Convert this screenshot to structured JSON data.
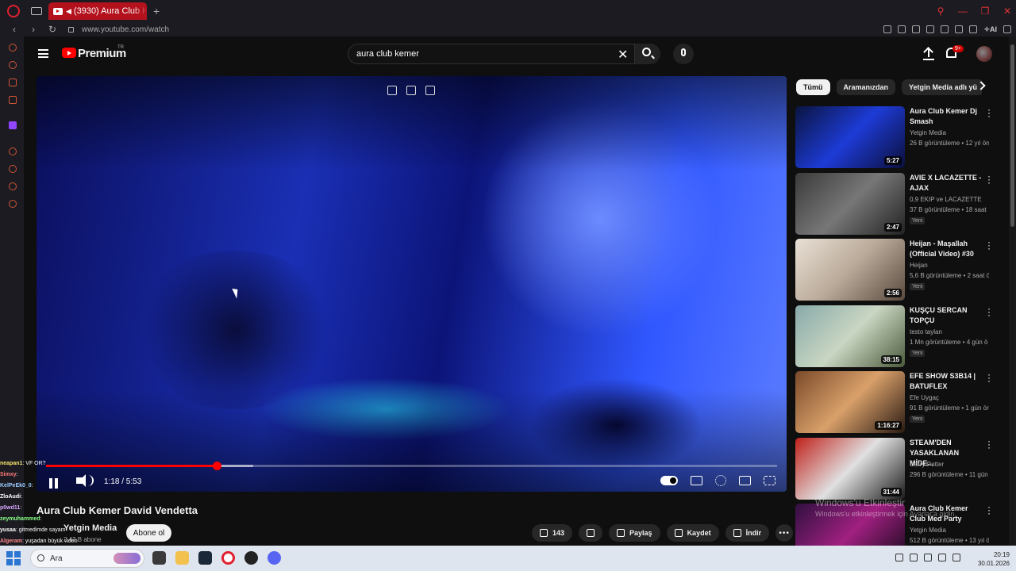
{
  "browser": {
    "tab_title": "(3930) Aura Club Keme",
    "url": "www.youtube.com/watch"
  },
  "yt": {
    "brand": "Premium",
    "country": "TR",
    "search_value": "aura club kemer",
    "notif_badge": "9+"
  },
  "player": {
    "time": "1:18 / 5:53",
    "progress_fraction": 0.233,
    "loaded_fraction": 0.283
  },
  "video": {
    "title": "Aura Club Kemer David Vendetta",
    "channel": "Yetgin Media",
    "subscribers": "2,43 B abone",
    "subscribe_label": "Abone ol",
    "likes": "143",
    "share_label": "Paylaş",
    "save_label": "Kaydet",
    "download_label": "İndir"
  },
  "chat": [
    {
      "user": "neapan1",
      "text": ": VF OR?"
    },
    {
      "user": "Simxy",
      "text": ":"
    },
    {
      "user": "KelPeEk0_0",
      "text": ":"
    },
    {
      "user": "ZloAudi",
      "text": ": "
    },
    {
      "user": "p0wd11",
      "text": ":"
    },
    {
      "user": "zeymuhammed",
      "text": ":"
    },
    {
      "user": "yusaa",
      "text": ": gitmedimde sayam"
    },
    {
      "user": "Algeram",
      "text": ": yuşadan büyük video"
    }
  ],
  "chips": [
    "Tümü",
    "Aramanızdan",
    "Yetgin Media adlı yü"
  ],
  "recommendations": [
    {
      "title": "Aura Club Kemer Dj Smash",
      "channel": "Yetgin Media",
      "meta": "26 B görüntüleme • 12 yıl ön",
      "duration": "5:27",
      "new": ""
    },
    {
      "title": "AVIE X LACAZETTE - AJAX",
      "channel": "0,9 EKIP ve LACAZETTE",
      "meta": "37 B görüntüleme • 18 saat",
      "duration": "2:47",
      "new": "Yeni"
    },
    {
      "title": "Heijan - Maşallah (Official Video) #30",
      "channel": "Heijan",
      "meta": "5,6 B görüntüleme • 2 saat ö",
      "duration": "2:56",
      "new": "Yeni"
    },
    {
      "title": "KUŞÇU SERCAN TOPÇU",
      "channel": "testo taylan",
      "meta": "1 Mn görüntüleme • 4 gün ö",
      "duration": "38:15",
      "new": "Yeni"
    },
    {
      "title": "EFE SHOW S3B14 | BATUFLEX",
      "channel": "Efe Uygaç",
      "meta": "91 B görüntüleme • 1 gün ön",
      "duration": "1:16:27",
      "new": "Yeni"
    },
    {
      "title": "STEAM'DEN YASAKLANAN MİDE...",
      "channel": "Carry Potter",
      "meta": "296 B görüntüleme • 11 gün",
      "duration": "31:44",
      "new": ""
    },
    {
      "title": "Aura Club Kemer Club Med Party",
      "channel": "Yetgin Media",
      "meta": "512 B görüntüleme • 13 yıl ö",
      "duration": "",
      "new": ""
    }
  ],
  "windows_watermark": {
    "line1": "Windows'u Etkinleştir",
    "line2": "Windows'u etkinleştirmek için Ayarlar'a gidin."
  },
  "taskbar": {
    "search_placeholder": "Ara",
    "time": "20:19",
    "date": "30.01.2026"
  },
  "colors": {
    "accent": "#ff0000",
    "background": "#0f0f0f",
    "tab": "#b3121d"
  }
}
